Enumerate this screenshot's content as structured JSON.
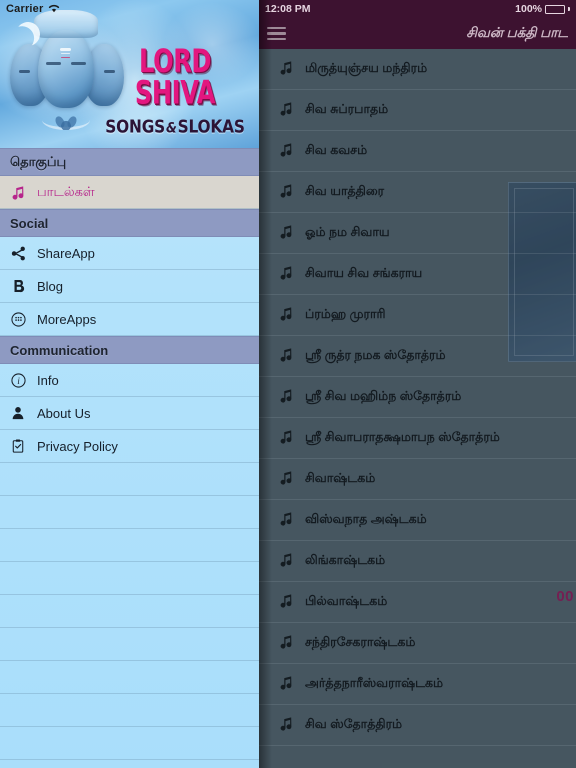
{
  "status_bar_left": {
    "carrier": "Carrier",
    "wifi_icon": "wifi-icon"
  },
  "status_bar_right": {
    "time": "12:08 PM",
    "battery_percent": "100%",
    "battery_icon": "battery-full-icon"
  },
  "hero": {
    "title_main": "LORD SHIVA",
    "title_sub_left": "SONGS",
    "title_amp": "&",
    "title_sub_right": "SLOKAS",
    "artwork": "lord-shiva-artwork"
  },
  "navbar": {
    "menu_icon": "hamburger-menu-icon",
    "title": "சிவன் பக்தி பாட"
  },
  "drawer": {
    "sections": [
      {
        "header": "தொகுப்பு",
        "items": [
          {
            "label": "பாடல்கள்",
            "icon": "music-note-icon",
            "selected": true
          }
        ]
      },
      {
        "header": "Social",
        "items": [
          {
            "label": "ShareApp",
            "icon": "share-icon",
            "selected": false
          },
          {
            "label": "Blog",
            "icon": "blog-icon",
            "selected": false
          },
          {
            "label": "MoreApps",
            "icon": "apps-grid-icon",
            "selected": false
          }
        ]
      },
      {
        "header": "Communication",
        "items": [
          {
            "label": "Info",
            "icon": "info-icon",
            "selected": false
          },
          {
            "label": "About Us",
            "icon": "person-icon",
            "selected": false
          },
          {
            "label": "Privacy Policy",
            "icon": "clipboard-check-icon",
            "selected": false
          }
        ]
      }
    ],
    "empty_row_count": 9
  },
  "song_list": {
    "row_icon": "music-note-icon",
    "items": [
      "மிருத்யுஞ்சய மந்திரம்",
      "சிவ சுப்ரபாதம்",
      "சிவ கவசம்",
      "சிவ யாத்திரை",
      "ஓம் நம சிவாய",
      "சிவாய சிவ சங்கராய",
      "ப்ரம்ஹ முராரி",
      "ஸ்ரீ ருத்ர நமக ஸ்தோத்ரம்",
      "ஸ்ரீ சிவ மஹிம்ந ஸ்தோத்ரம்",
      "ஸ்ரீ சிவாபராதக்ஷமாபந ஸ்தோத்ரம்",
      "சிவாஷ்டகம்",
      "விஸ்வநாத அஷ்டகம்",
      "லிங்காஷ்டகம்",
      "பில்வாஷ்டகம்",
      "சந்திரசேகராஷ்டகம்",
      "அர்த்தநாரீஸ்வராஷ்டகம்",
      "சிவ ஸ்தோத்திரம்"
    ]
  },
  "player": {
    "timer": "00",
    "album_art": "album-art-placeholder"
  },
  "colors": {
    "navbar": "#3d1230",
    "accent_pink": "#e3167f",
    "selected_text": "#b6258b",
    "section_header_bg": "#8e9ac2",
    "drawer_bg": "#b2e2fb",
    "content_bg": "#5b6e78"
  }
}
